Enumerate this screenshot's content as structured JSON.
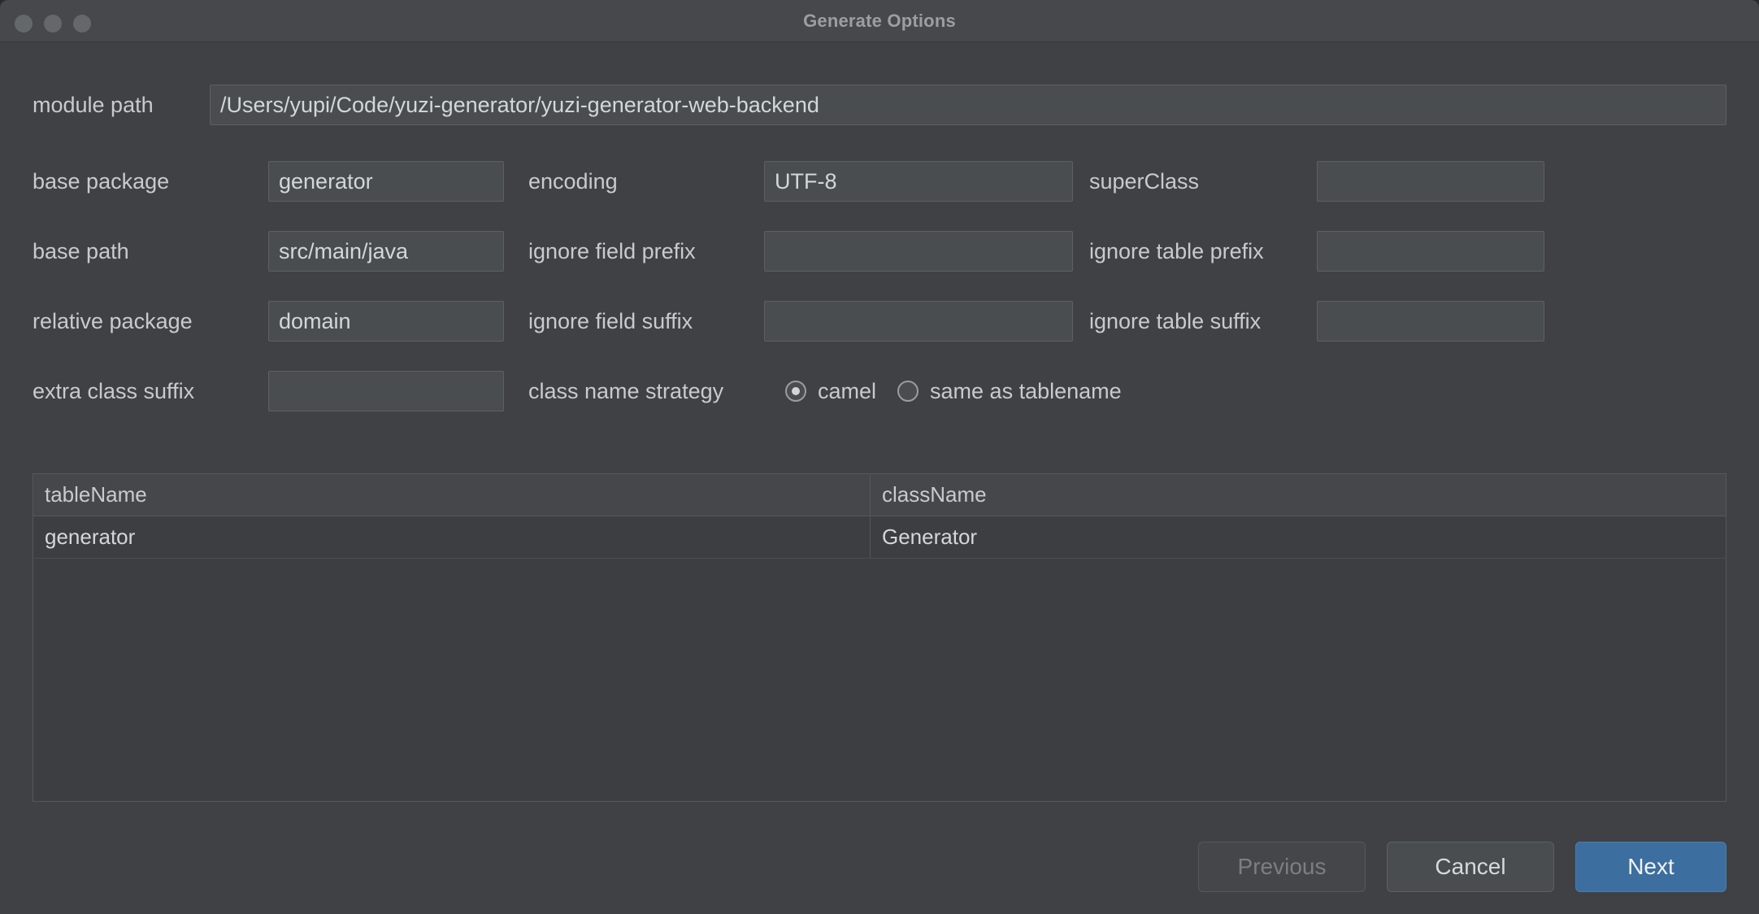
{
  "window": {
    "title": "Generate Options",
    "traffic_lights": [
      "close-dot",
      "minimize-dot",
      "zoom-dot"
    ],
    "accent_color": "#3c6e9f",
    "background_color": "#3f4144",
    "titlebar_color": "#46484b"
  },
  "form": {
    "module_path": {
      "label": "module path",
      "value": "/Users/yupi/Code/yuzi-generator/yuzi-generator-web-backend"
    },
    "rows": [
      {
        "left": {
          "label": "base package",
          "value": "generator"
        },
        "middle": {
          "label": "encoding",
          "value": "UTF-8"
        },
        "right": {
          "label": "superClass",
          "value": ""
        }
      },
      {
        "left": {
          "label": "base path",
          "value": "src/main/java"
        },
        "middle": {
          "label": "ignore field prefix",
          "value": ""
        },
        "right": {
          "label": "ignore table prefix",
          "value": ""
        }
      },
      {
        "left": {
          "label": "relative package",
          "value": "domain"
        },
        "middle": {
          "label": "ignore field suffix",
          "value": ""
        },
        "right": {
          "label": "ignore table suffix",
          "value": ""
        }
      }
    ],
    "extra_class_suffix": {
      "label": "extra class suffix",
      "value": ""
    },
    "class_name_strategy": {
      "label": "class name strategy",
      "options": [
        {
          "label": "camel",
          "selected": true
        },
        {
          "label": "same as tablename",
          "selected": false
        }
      ]
    }
  },
  "table": {
    "columns": [
      "tableName",
      "className"
    ],
    "rows": [
      {
        "tableName": "generator",
        "className": "Generator"
      }
    ]
  },
  "footer": {
    "previous_label": "Previous",
    "cancel_label": "Cancel",
    "next_label": "Next"
  }
}
